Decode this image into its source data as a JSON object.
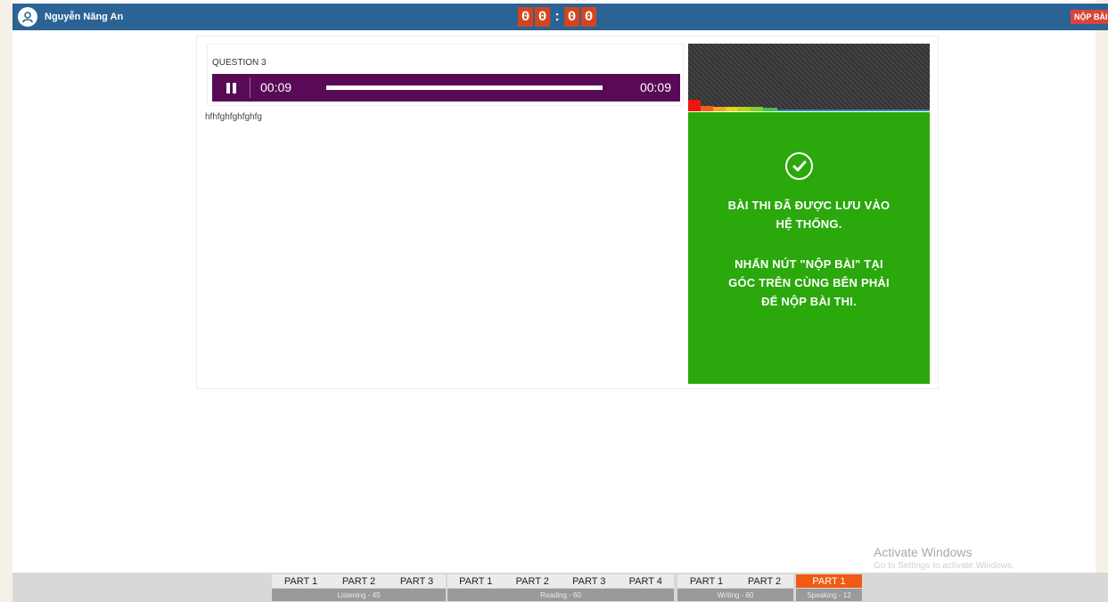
{
  "header": {
    "user_name": "Nguyễn Năng An",
    "timer": {
      "d1": "0",
      "d2": "0",
      "colon": ":",
      "d3": "0",
      "d4": "0"
    },
    "submit_label": "NỘP BÀI"
  },
  "question": {
    "title": "QUESTION 3",
    "player": {
      "current_time": "00:09",
      "total_time": "00:09",
      "progress": 1.0
    },
    "answer_text": "hfhfghfghfghfg"
  },
  "status": {
    "icon": "check-circle-icon",
    "line1": "BÀI THI ĐÃ ĐƯỢC LƯU VÀO",
    "line2": "HỆ THỐNG.",
    "line3": "NHẤN NÚT \"NỘP BÀI\" TẠI",
    "line4": "GÓC TRÊN CÙNG BÊN PHẢI",
    "line5": "ĐỂ NỘP BÀI THI.",
    "bg_color": "#2aa80c"
  },
  "sections": [
    {
      "label": "Listening - 45",
      "parts": [
        "PART 1",
        "PART 2",
        "PART 3"
      ]
    },
    {
      "label": "Reading - 60",
      "parts": [
        "PART 1",
        "PART 2",
        "PART 3",
        "PART 4"
      ]
    },
    {
      "label": "Writing - 60",
      "parts": [
        "PART 1",
        "PART 2"
      ]
    },
    {
      "label": "Speaking - 12",
      "parts": [
        "PART 1"
      ],
      "active": true
    }
  ],
  "watermark": {
    "title": "Activate Windows",
    "subtitle": "Go to Settings to activate Windows."
  },
  "colors": {
    "header": "#2b6395",
    "timer": "#d2451f",
    "player": "#580a56",
    "active_section": "#f05a12"
  }
}
